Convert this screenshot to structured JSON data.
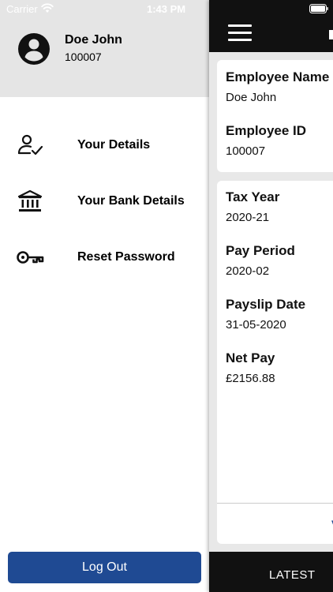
{
  "status_bar": {
    "carrier": "Carrier",
    "time": "1:43 PM"
  },
  "drawer": {
    "user": {
      "name": "Doe John",
      "id": "100007",
      "icon": "account-circle-icon"
    },
    "menu": [
      {
        "label": "Your Details",
        "icon": "person-check-icon"
      },
      {
        "label": "Your Bank Details",
        "icon": "bank-icon"
      },
      {
        "label": "Reset Password",
        "icon": "key-icon"
      }
    ],
    "logout_label": "Log Out"
  },
  "main": {
    "employee_card": {
      "fields": [
        {
          "label": "Employee Name",
          "value": "Doe John"
        },
        {
          "label": "Employee ID",
          "value": "100007"
        }
      ]
    },
    "pay_card": {
      "fields": [
        {
          "label": "Tax Year",
          "value": "2020-21"
        },
        {
          "label": "Pay Period",
          "value": "2020-02"
        },
        {
          "label": "Payslip Date",
          "value": "31-05-2020"
        },
        {
          "label": "Net Pay",
          "value": "£2156.88"
        }
      ],
      "footer_stub": "V"
    },
    "bottom_tab": "LATEST"
  },
  "colors": {
    "accent": "#1f4a93",
    "header_bg": "#e5e5e5",
    "bar_bg": "#111111"
  }
}
